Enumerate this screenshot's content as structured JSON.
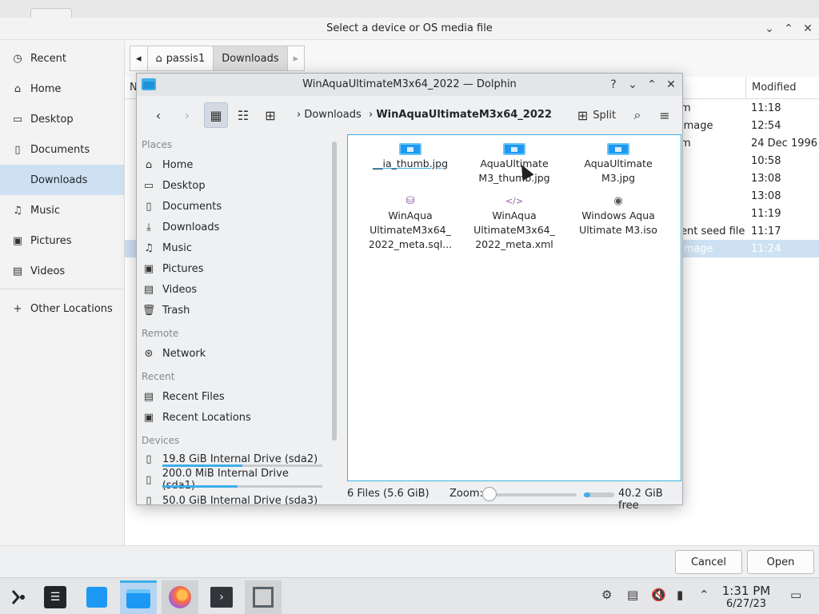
{
  "bg_dialog": {
    "title": "Select a device or OS media file",
    "sidebar": [
      {
        "icon": "clock-icon",
        "label": "Recent"
      },
      {
        "icon": "home-icon",
        "label": "Home"
      },
      {
        "icon": "desktop-icon",
        "label": "Desktop"
      },
      {
        "icon": "document-icon",
        "label": "Documents"
      },
      {
        "icon": "download-icon",
        "label": "Downloads",
        "active": true
      },
      {
        "icon": "music-icon",
        "label": "Music"
      },
      {
        "icon": "picture-icon",
        "label": "Pictures"
      },
      {
        "icon": "video-icon",
        "label": "Videos"
      },
      {
        "icon": "plus-icon",
        "label": "Other Locations"
      }
    ],
    "path": [
      "passis1",
      "Downloads"
    ],
    "columns": {
      "name": "N",
      "modified": "Modified"
    },
    "rows": [
      {
        "type": "m",
        "time": "11:18"
      },
      {
        "type": " image",
        "time": "12:54"
      },
      {
        "type": "m",
        "time": "24 Dec 1996"
      },
      {
        "type": "",
        "time": "10:58"
      },
      {
        "type": "",
        "time": "13:08"
      },
      {
        "type": "",
        "time": "13:08"
      },
      {
        "type": "",
        "time": "11:19"
      },
      {
        "type": "ent seed file",
        "time": "11:17"
      },
      {
        "type": " image",
        "time": "11:24"
      }
    ],
    "cancel": "Cancel",
    "open": "Open"
  },
  "dolphin": {
    "title": "WinAquaUltimateM3x64_2022 — Dolphin",
    "crumbs": [
      "Downloads",
      "WinAquaUltimateM3x64_2022"
    ],
    "split": "Split",
    "places_head": "Places",
    "places": [
      {
        "icon": "home-icon",
        "label": "Home"
      },
      {
        "icon": "desktop-icon",
        "label": "Desktop"
      },
      {
        "icon": "document-icon",
        "label": "Documents"
      },
      {
        "icon": "download-icon",
        "label": "Downloads"
      },
      {
        "icon": "music-icon",
        "label": "Music"
      },
      {
        "icon": "picture-icon",
        "label": "Pictures"
      },
      {
        "icon": "video-icon",
        "label": "Videos"
      },
      {
        "icon": "trash-icon",
        "label": "Trash"
      }
    ],
    "remote_head": "Remote",
    "remote": [
      {
        "icon": "network-icon",
        "label": "Network"
      }
    ],
    "recent_head": "Recent",
    "recent": [
      {
        "icon": "recent-files-icon",
        "label": "Recent Files"
      },
      {
        "icon": "recent-locations-icon",
        "label": "Recent Locations"
      }
    ],
    "devices_head": "Devices",
    "devices": [
      {
        "label": "19.8 GiB Internal Drive (sda2)",
        "used_fraction": 0.5
      },
      {
        "label": "200.0 MiB Internal Drive (sda1)",
        "used_fraction": 0.47
      },
      {
        "label": "50.0 GiB Internal Drive (sda3)",
        "used_fraction": 0.0
      }
    ],
    "files": [
      {
        "kind": "image",
        "line1": "__ia_thumb.jpg",
        "line2": "",
        "line3": ""
      },
      {
        "kind": "image",
        "line1": "AquaUltimate",
        "line2": "M3_thumb.jpg",
        "line3": ""
      },
      {
        "kind": "image",
        "line1": "AquaUltimate",
        "line2": "M3.jpg",
        "line3": ""
      },
      {
        "kind": "database",
        "line1": "WinAqua",
        "line2": "UltimateM3x64_",
        "line3": "2022_meta.sql..."
      },
      {
        "kind": "xml",
        "line1": "WinAqua",
        "line2": "UltimateM3x64_",
        "line3": "2022_meta.xml"
      },
      {
        "kind": "disc",
        "line1": "Windows Aqua",
        "line2": "Ultimate M3.iso",
        "line3": ""
      }
    ],
    "status": {
      "files": "6 Files (5.6 GiB)",
      "zoom_label": "Zoom:",
      "free": "40.2 GiB free",
      "zoom_level": 0.0,
      "used_fraction": 0.2
    }
  },
  "taskbar": {
    "time": "1:31 PM",
    "date": "6/27/23"
  },
  "colors": {
    "accent": "#3daee9",
    "selection": "#cde1f3"
  }
}
